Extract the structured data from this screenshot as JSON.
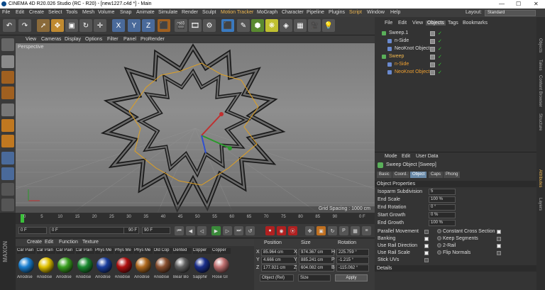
{
  "window": {
    "title": "CINEMA 4D R20.026 Studio (RC - R20) - [new1227.c4d *] - Main",
    "minimize": "—",
    "maximize": "☐",
    "close": "✕"
  },
  "menubar": {
    "items": [
      "File",
      "Edit",
      "Create",
      "Select",
      "Tools",
      "Mesh",
      "Volume",
      "Snap",
      "Animate",
      "Simulate",
      "Render",
      "Sculpt",
      "Motion Tracker",
      "MoGraph",
      "Character",
      "Pipeline",
      "Plugins",
      "Script",
      "Window",
      "Help"
    ],
    "highlight": [
      "Motion Tracker",
      "Script"
    ],
    "layout_label": "Layout:",
    "layout_value": "Standard"
  },
  "viewport": {
    "menu": [
      "View",
      "Cameras",
      "Display",
      "Options",
      "Filter",
      "Panel",
      "ProRender"
    ],
    "label": "Perspective",
    "grid_spacing": "Grid Spacing : 1000 cm"
  },
  "timeline": {
    "ticks": [
      "0",
      "5",
      "10",
      "15",
      "20",
      "25",
      "30",
      "35",
      "40",
      "45",
      "50",
      "55",
      "60",
      "65",
      "70",
      "75",
      "80",
      "85",
      "90"
    ],
    "end_label": "0 F"
  },
  "transport": {
    "start": "0 F",
    "current": "0 F",
    "preview_end": "90 F",
    "end": "90 F"
  },
  "materials": {
    "menu": [
      "Create",
      "Edit",
      "Function",
      "Texture"
    ],
    "items": [
      {
        "name": "Car Pain",
        "label": "Anodise",
        "color": "#1a7fd0"
      },
      {
        "name": "Car Pain",
        "label": "Anodise",
        "color": "#e0c000"
      },
      {
        "name": "Car Pain",
        "label": "Anodise",
        "color": "#3aa020"
      },
      {
        "name": "Car Pain",
        "label": "Anodise",
        "color": "#1a8a30"
      },
      {
        "name": "Phys Me",
        "label": "Anodise",
        "color": "#1a3e9e"
      },
      {
        "name": "Phys Me",
        "label": "Anodise",
        "color": "#b01010"
      },
      {
        "name": "Phys Me",
        "label": "Anodise",
        "color": "#b06a20"
      },
      {
        "name": "Old Cop",
        "label": "Anodise",
        "color": "#8a5030"
      },
      {
        "name": "Dented",
        "label": "Bear Bo",
        "color": "#606060"
      },
      {
        "name": "Copper",
        "label": "Sapphir",
        "color": "#1a2e8a"
      },
      {
        "name": "Copper",
        "label": "Rose Gl",
        "color": "#c07070"
      }
    ]
  },
  "coords": {
    "headers": [
      "Position",
      "Size",
      "Rotation"
    ],
    "rows": [
      {
        "axis": "X",
        "pos": "85.964 cm",
        "size": "974.367 cm",
        "rax": "H",
        "rot": "225.759 °"
      },
      {
        "axis": "Y",
        "pos": "4.666 cm",
        "size": "885.241 cm",
        "rax": "P",
        "rot": "-1.215 °"
      },
      {
        "axis": "Z",
        "pos": "177.921 cm",
        "size": "604.082 cm",
        "rax": "B",
        "rot": "-115.062 °"
      }
    ],
    "mode": "Object (Rel)",
    "size_mode": "Size",
    "apply": "Apply"
  },
  "objects": {
    "menu": [
      "File",
      "Edit",
      "View",
      "Objects",
      "Tags",
      "Bookmarks"
    ],
    "rows": [
      {
        "name": "Sweep.1",
        "color": "#dddddd",
        "indent": 0
      },
      {
        "name": "n-Side",
        "color": "#dddddd",
        "indent": 1
      },
      {
        "name": "NeoKnot Object",
        "color": "#dddddd",
        "indent": 1
      },
      {
        "name": "Sweep",
        "color": "#f0b850",
        "indent": 0
      },
      {
        "name": "n-Side",
        "color": "#f0a030",
        "indent": 1
      },
      {
        "name": "NeoKnot Object",
        "color": "#f0a030",
        "indent": 1
      }
    ]
  },
  "right_tabs": [
    "Objects",
    "Takes",
    "Content Browser",
    "Structure",
    "Attributes",
    "Layers"
  ],
  "attributes": {
    "menu": [
      "Mode",
      "Edit",
      "User Data"
    ],
    "title": "Sweep Object [Sweep]",
    "tabs": [
      "Basic",
      "Coord.",
      "Object",
      "Caps",
      "Phong"
    ],
    "active_tab": "Object",
    "section": "Object Properties",
    "props": [
      {
        "label": "Isoparm Subdivision",
        "value": "5"
      },
      {
        "label": "End Scale",
        "value": "100 %"
      },
      {
        "label": "End Rotation",
        "value": "0 °"
      },
      {
        "label": "Start Growth",
        "value": "0 %"
      },
      {
        "label": "End Growth",
        "value": "100 %"
      }
    ],
    "checks_left": [
      {
        "label": "Parallel Movement",
        "checked": false
      },
      {
        "label": "Banking",
        "checked": true
      },
      {
        "label": "Use Rail Direction",
        "checked": true
      },
      {
        "label": "Use Rail Scale",
        "checked": true
      },
      {
        "label": "Stick UVs",
        "checked": false
      }
    ],
    "checks_right": [
      {
        "label": "Constant Cross Section",
        "checked": true
      },
      {
        "label": "Keep Segments",
        "checked": false
      },
      {
        "label": "2-Rail",
        "checked": true
      },
      {
        "label": "Flip Normals",
        "checked": false
      }
    ],
    "details": "Details"
  },
  "colors": {
    "accent": "#f0b850",
    "active_tab": "#6a8aa8",
    "check": "#eeeeee"
  }
}
